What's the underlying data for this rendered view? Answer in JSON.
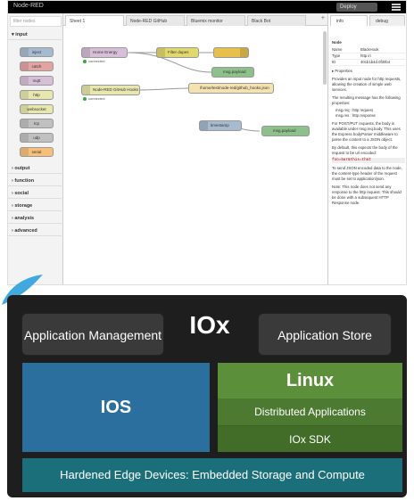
{
  "nodered": {
    "app_name": "Node-RED",
    "deploy_label": "Deploy",
    "palette": {
      "filter_placeholder": "filter nodes",
      "category_input": "input",
      "input_nodes": [
        "inject",
        "catch",
        "mqtt",
        "http",
        "websocket",
        "tcp",
        "udp",
        "serial"
      ],
      "categories": [
        "output",
        "function",
        "social",
        "storage",
        "analysis",
        "advanced"
      ]
    },
    "tabs": [
      "Sheet 1",
      "Node-RED GitHub",
      "Bluemix monitor",
      "Black Bot"
    ],
    "flow": {
      "home_energy": "Home Energy",
      "connected_1": "connected",
      "filter_dupes": "Filter dupes",
      "msg_payload_1": "msg.payload",
      "github_hooks": "Node-RED GitHub Hooks",
      "connected_2": "connected",
      "github_file": "/home/test/node-red/github_hooks.json",
      "timestamp": "timestamp",
      "msg_payload_2": "msg.payload"
    },
    "sidebar": {
      "tab_info": "info",
      "tab_debug": "debug",
      "section_node": "Node",
      "name_label": "Name",
      "name_value": "BlackHook",
      "type_label": "Type",
      "type_value": "http in",
      "id_label": "ID",
      "id_value": "40cb1b4d.0f30b4",
      "properties": "▸ Properties",
      "desc1": "Provides an input node for http requests, allowing the creation of simple web services.",
      "desc2": "The resulting message has the following properties:",
      "bullet1": "msg.req : http request",
      "bullet2": "msg.res : http response",
      "desc3": "For POST/PUT requests, the body is available under msg.req.body. This uses the Express bodyParser middleware to parse the content to a JSON object.",
      "desc4": "By default, this expects the body of the request to be url encoded:",
      "code1": "foo=bar&this=that",
      "desc5": "To send JSON encoded data to the node, the content-type header of the request must be set to application/json.",
      "desc6": "Note: This node does not send any response to the http request. This should be done with a subsequent HTTP Response node."
    }
  },
  "iox": {
    "title": "IOx",
    "app_management": "Application Management",
    "app_store": "Application Store",
    "ios": "IOS",
    "linux": "Linux",
    "distributed_apps": "Distributed Applications",
    "iox_sdk": "IOx SDK",
    "hardened": "Hardened Edge Devices: Embedded Storage and Compute"
  },
  "colors": {
    "iox_blue": "#2b6f9e",
    "iox_green": "#5c8f3a",
    "iox_teal": "#1b6f7a",
    "swoosh": "#3fa9e0"
  }
}
